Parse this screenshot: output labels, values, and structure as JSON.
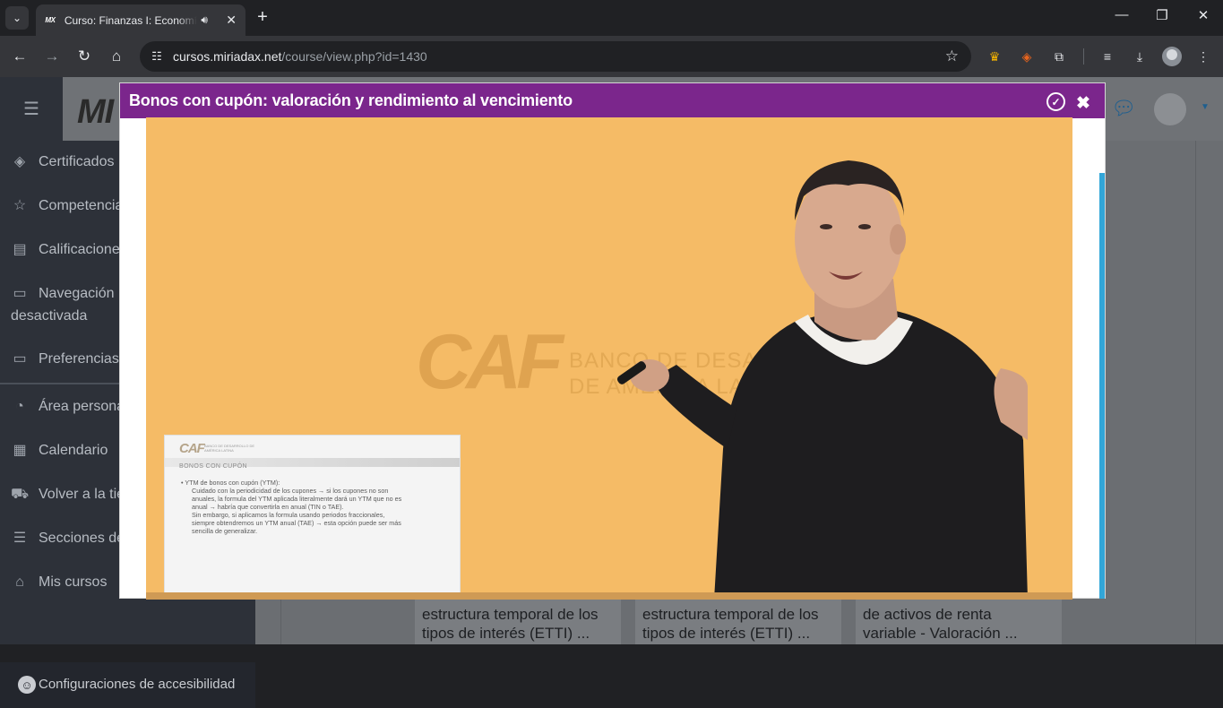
{
  "browser": {
    "tab": {
      "favicon": "MX",
      "title": "Curso: Finanzas I: Economía",
      "audio_icon": "speaker-icon",
      "close_icon": "close-icon"
    },
    "new_tab_icon": "plus-icon",
    "window_controls": {
      "minimize": "—",
      "maximize": "❐",
      "close": "✕"
    },
    "url_host": "cursos.miriadax.net",
    "url_path": "/course/view.php?id=1430"
  },
  "site": {
    "logo": "MI",
    "sidebar": {
      "items": [
        {
          "label": "Certificados",
          "icon": "layers-icon"
        },
        {
          "label": "Competencias",
          "icon": "star-icon"
        },
        {
          "label": "Calificaciones",
          "icon": "book-icon"
        },
        {
          "label": "Navegación",
          "label2": "desactivada",
          "icon": "folder-icon"
        },
        {
          "label": "Preferencias",
          "icon": "folder-icon"
        },
        {
          "label": "Área personal",
          "icon": "dashboard-icon"
        },
        {
          "label": "Calendario",
          "icon": "calendar-icon"
        },
        {
          "label": "Volver a la tienda",
          "icon": "cart-icon"
        },
        {
          "label": "Secciones del curso",
          "icon": "list-icon"
        },
        {
          "label": "Mis cursos",
          "icon": "graduation-cap-icon"
        }
      ],
      "accessibility": "Configuraciones de accesibilidad"
    },
    "cards": [
      {
        "line1": "estructura temporal de los",
        "line2": "tipos de interés (ETTI) ..."
      },
      {
        "line1": "estructura temporal de los",
        "line2": "tipos de interés (ETTI) ..."
      },
      {
        "line1": "de activos de renta",
        "line2": "variable - Valoración ..."
      }
    ]
  },
  "modal": {
    "title": "Bonos con cupón: valoración y rendimiento al vencimiento",
    "watermark": {
      "brand": "CAF",
      "line1": "BANCO DE DESARROLLO",
      "line2": "DE AMÉRICA LATINA"
    },
    "slide": {
      "logo": "CAF",
      "logo_sub": "BANCO DE DESARROLLO DE AMÉRICA LATINA",
      "heading": "BONOS CON CUPÓN",
      "bullet": "• YTM de bonos con cupón (YTM):",
      "lines": [
        "Cuidado con la periodicidad de los cupones → si los cupones no son",
        "anuales, la formula del YTM aplicada literalmente dará un YTM que no es",
        "anual → habría que convertirla en anual (TIN o TAE).",
        "Sin embargo, si aplicamos la formula usando periodos fraccionales,",
        "siempre obtendremos un YTM anual (TAE) → esta opción puede ser más",
        "sencilla de generalizar."
      ]
    }
  }
}
